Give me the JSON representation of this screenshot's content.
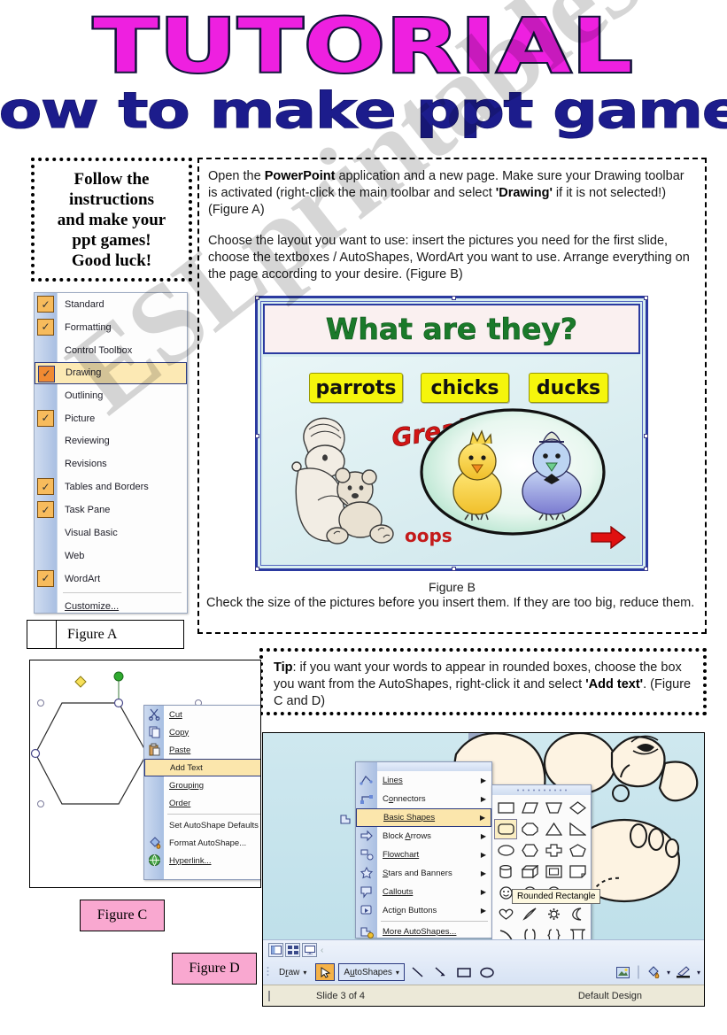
{
  "title": {
    "main": "TUTORIAL",
    "subtitle": "How to make ppt games",
    "main_color": "#EE20E0",
    "subtitle_color": "#1C1C8C"
  },
  "watermark": {
    "text": "ESLprintables.com"
  },
  "follow_box": {
    "lines": [
      "Follow the",
      "instructions",
      "and make your",
      "ppt games!",
      "Good luck!"
    ]
  },
  "step1": {
    "paragraph1_parts": [
      "Open the ",
      "PowerPoint",
      " application and a new page. Make sure your Drawing toolbar is activated (right-click the main toolbar and select ",
      "'Drawing'",
      " if it is not selected!) (Figure A)"
    ],
    "paragraph2": "Choose the layout you want to use: insert the pictures you need for the first slide, choose the textboxes / AutoShapes, WordArt you want to use. Arrange everything on the page according to your desire. (Figure B)"
  },
  "figure_a": {
    "label": "Figure A",
    "menu_items": [
      {
        "label": "Standard",
        "checked": true,
        "selected": false
      },
      {
        "label": "Formatting",
        "checked": true,
        "selected": false
      },
      {
        "label": "Control Toolbox",
        "checked": false,
        "selected": false
      },
      {
        "label": "Drawing",
        "checked": true,
        "selected": true
      },
      {
        "label": "Outlining",
        "checked": false,
        "selected": false
      },
      {
        "label": "Picture",
        "checked": true,
        "selected": false
      },
      {
        "label": "Reviewing",
        "checked": false,
        "selected": false
      },
      {
        "label": "Revisions",
        "checked": false,
        "selected": false
      },
      {
        "label": "Tables and Borders",
        "checked": true,
        "selected": false
      },
      {
        "label": "Task Pane",
        "checked": true,
        "selected": false
      },
      {
        "label": "Visual Basic",
        "checked": false,
        "selected": false
      },
      {
        "label": "Web",
        "checked": false,
        "selected": false
      },
      {
        "label": "WordArt",
        "checked": true,
        "selected": false
      }
    ],
    "customize_label": "Customize...",
    "check_glyph": "✓"
  },
  "figure_b": {
    "caption": "Figure B",
    "note": "Check the size of the pictures before you insert them. If they are too big, reduce them.",
    "slide": {
      "title": "What are they?",
      "chips": [
        "parrots",
        "chicks",
        "ducks"
      ],
      "feedback_correct": "Great!",
      "feedback_wrong": "oops",
      "chip_color": "#f5f50c",
      "title_color": "#1a7a2a"
    }
  },
  "tip": {
    "label": "Tip",
    "text_part1": ": if you want your words to appear in rounded boxes, choose the box you want from the AutoShapes, right-click it and select ",
    "bold_part": "'Add text'",
    "text_part2": ". (Figure C and D)"
  },
  "figure_c": {
    "label": "Figure C",
    "context_menu": [
      {
        "label": "Cut",
        "icon": "scissors-icon",
        "submenu": false,
        "selected": false
      },
      {
        "label": "Copy",
        "icon": "copy-icon",
        "submenu": false,
        "selected": false
      },
      {
        "label": "Paste",
        "icon": "paste-icon",
        "submenu": false,
        "selected": false
      },
      {
        "label": "Add Text",
        "icon": "",
        "submenu": false,
        "selected": true
      },
      {
        "label": "Grouping",
        "icon": "",
        "submenu": true,
        "selected": false
      },
      {
        "label": "Order",
        "icon": "",
        "submenu": true,
        "selected": false
      },
      {
        "label": "Set AutoShape Defaults",
        "icon": "",
        "submenu": false,
        "selected": false
      },
      {
        "label": "Format AutoShape...",
        "icon": "paint-icon",
        "submenu": false,
        "selected": false
      },
      {
        "label": "Hyperlink...",
        "icon": "globe-icon",
        "submenu": false,
        "selected": false
      }
    ],
    "submenu_arrow": "▶"
  },
  "figure_d": {
    "label": "Figure D",
    "autoshapes_menu": [
      {
        "label": "Lines",
        "submenu": true,
        "selected": false
      },
      {
        "label": "Connectors",
        "submenu": true,
        "selected": false
      },
      {
        "label": "Basic Shapes",
        "submenu": true,
        "selected": true
      },
      {
        "label": "Block Arrows",
        "submenu": true,
        "selected": false
      },
      {
        "label": "Flowchart",
        "submenu": true,
        "selected": false
      },
      {
        "label": "Stars and Banners",
        "submenu": true,
        "selected": false
      },
      {
        "label": "Callouts",
        "submenu": true,
        "selected": false
      },
      {
        "label": "Action Buttons",
        "submenu": true,
        "selected": false
      }
    ],
    "more_autoshapes": "More AutoShapes...",
    "tooltip": "Rounded Rectangle",
    "shape_cells": [
      "rectangle",
      "parallelogram",
      "trapezoid",
      "diamond",
      "rounded-rectangle",
      "octagon",
      "triangle",
      "right-triangle",
      "oval",
      "hexagon",
      "cross",
      "pentagon",
      "cylinder",
      "cube",
      "bevel",
      "folded-corner",
      "smiley-face",
      "donut",
      "no-symbol",
      "arc",
      "heart",
      "lightning-bolt",
      "sun",
      "moon",
      "curve",
      "bracket-pair",
      "brace-pair",
      "plaque",
      "left-bracket",
      "right-bracket",
      "left-brace",
      "right-brace"
    ],
    "selected_shape_index": 4,
    "toolbar": {
      "draw_label": "Draw",
      "autoshapes_label": "AutoShapes",
      "dropdown_arrow": "▾",
      "tools": [
        "line-tool",
        "arrow-tool",
        "rectangle-tool",
        "oval-tool"
      ],
      "right_tools": [
        "insert-picture-icon",
        "fill-color-icon",
        "line-color-icon"
      ]
    },
    "status": {
      "slide": "Slide 3 of 4",
      "design": "Default Design"
    }
  }
}
